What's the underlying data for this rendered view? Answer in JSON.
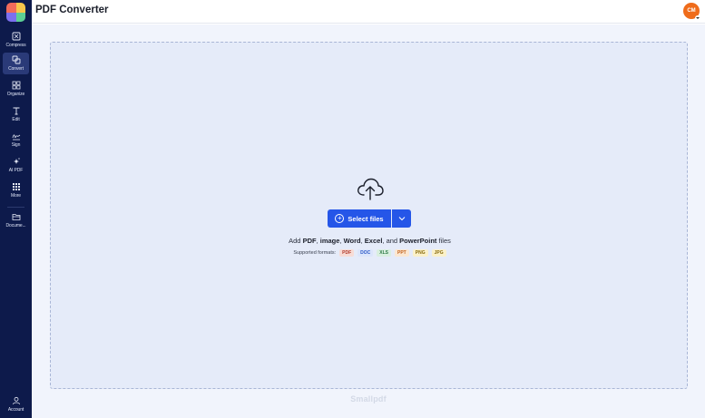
{
  "header": {
    "title": "PDF Converter",
    "avatar_initials": "CM",
    "avatar_color": "#ef6c1b"
  },
  "sidebar": {
    "items": [
      {
        "label": "Compress",
        "icon": "compress-icon"
      },
      {
        "label": "Convert",
        "icon": "convert-icon",
        "active": true
      },
      {
        "label": "Organize",
        "icon": "grid-icon"
      },
      {
        "label": "Edit",
        "icon": "text-icon"
      },
      {
        "label": "Sign",
        "icon": "signature-icon"
      },
      {
        "label": "AI PDF",
        "icon": "sparkle-icon"
      },
      {
        "label": "More",
        "icon": "apps-icon"
      },
      {
        "label": "Docume...",
        "icon": "folder-icon"
      }
    ],
    "account_label": "Account"
  },
  "upload": {
    "select_label": "Select files",
    "hint": {
      "prefix": "Add ",
      "pdf": "PDF",
      "sep1": ", ",
      "image": "image",
      "sep2": ", ",
      "word": "Word",
      "sep3": ", ",
      "excel": "Excel",
      "sep4": ", and ",
      "powerpoint": "PowerPoint",
      "suffix": " files"
    },
    "formats_label": "Supported formats:",
    "formats": [
      {
        "name": "PDF",
        "bg": "#f7dcd6",
        "fg": "#b23a2b"
      },
      {
        "name": "DOC",
        "bg": "#dbe5fb",
        "fg": "#2a56c6"
      },
      {
        "name": "XLS",
        "bg": "#d9efe0",
        "fg": "#2c7a45"
      },
      {
        "name": "PPT",
        "bg": "#fbe7d2",
        "fg": "#c2621d"
      },
      {
        "name": "PNG",
        "bg": "#fbf1c9",
        "fg": "#8a6d10"
      },
      {
        "name": "JPG",
        "bg": "#fbf1c9",
        "fg": "#8a6d10"
      }
    ]
  },
  "brand": "Smallpdf",
  "colors": {
    "sidebar": "#0d1a4b",
    "accent": "#2556e8",
    "dropzone": "#e5ebf9"
  }
}
